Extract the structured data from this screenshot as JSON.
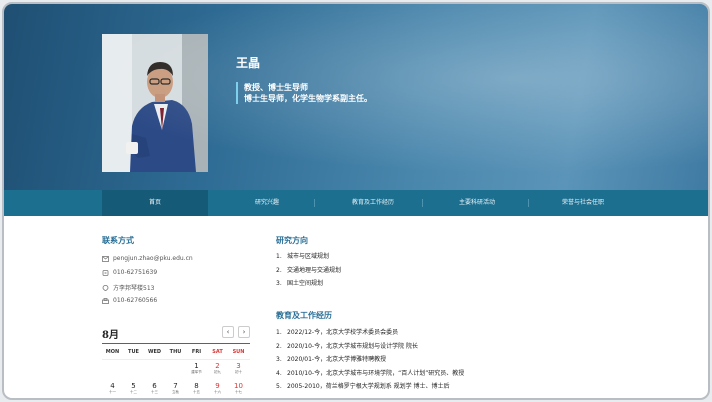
{
  "profile": {
    "name": "王晶",
    "title_line1": "教授、博士生导师",
    "title_line2": "博士生导师，化学生物学系副主任。"
  },
  "nav": {
    "items": [
      {
        "label": "首页"
      },
      {
        "label": "研究兴趣"
      },
      {
        "label": "教育及工作经历"
      },
      {
        "label": "主要科研活动"
      },
      {
        "label": "荣誉与社会任职"
      }
    ]
  },
  "contact": {
    "heading": "联系方式",
    "email": "pengjun.zhao@pku.edu.cn",
    "phone": "010-62751639",
    "office": "方李邦琴楼513",
    "fax": "010-62760566"
  },
  "research": {
    "heading": "研究方向",
    "items": [
      {
        "num": "1.",
        "text": "城市与区域规划"
      },
      {
        "num": "2.",
        "text": "交通地理与交通规划"
      },
      {
        "num": "3.",
        "text": "国土空间规划"
      }
    ]
  },
  "education": {
    "heading": "教育及工作经历",
    "items": [
      {
        "num": "1.",
        "text": "2022/12-今，北京大学校学术委员会委员"
      },
      {
        "num": "2.",
        "text": "2020/10-今，北京大学城市规划与设计学院 院长"
      },
      {
        "num": "3.",
        "text": "2020/01-今，北京大学博雅特聘教授"
      },
      {
        "num": "4.",
        "text": "2010/10-今，北京大学城市与环境学院，“百人计划”研究员、教授"
      },
      {
        "num": "5.",
        "text": "2005-2010，荷兰格罗宁根大学规划系 规划学 博士、博士后"
      }
    ]
  },
  "calendar": {
    "month": "8月",
    "prev": "‹",
    "next": "›",
    "weekdays": [
      "MON",
      "TUE",
      "WED",
      "THU",
      "FRI",
      "SAT",
      "SUN"
    ],
    "week1": [
      {
        "n": "1",
        "l": "建军节",
        "red": false
      },
      {
        "n": "2",
        "l": "初九",
        "red": true
      },
      {
        "n": "3",
        "l": "初十",
        "red": true
      }
    ],
    "week2": [
      {
        "n": "4",
        "l": "十一",
        "red": false
      },
      {
        "n": "5",
        "l": "十二",
        "red": false
      },
      {
        "n": "6",
        "l": "十三",
        "red": false
      },
      {
        "n": "7",
        "l": "立秋",
        "red": false
      },
      {
        "n": "8",
        "l": "十五",
        "red": false
      },
      {
        "n": "9",
        "l": "十六",
        "red": true
      },
      {
        "n": "10",
        "l": "十七",
        "red": true
      }
    ]
  }
}
